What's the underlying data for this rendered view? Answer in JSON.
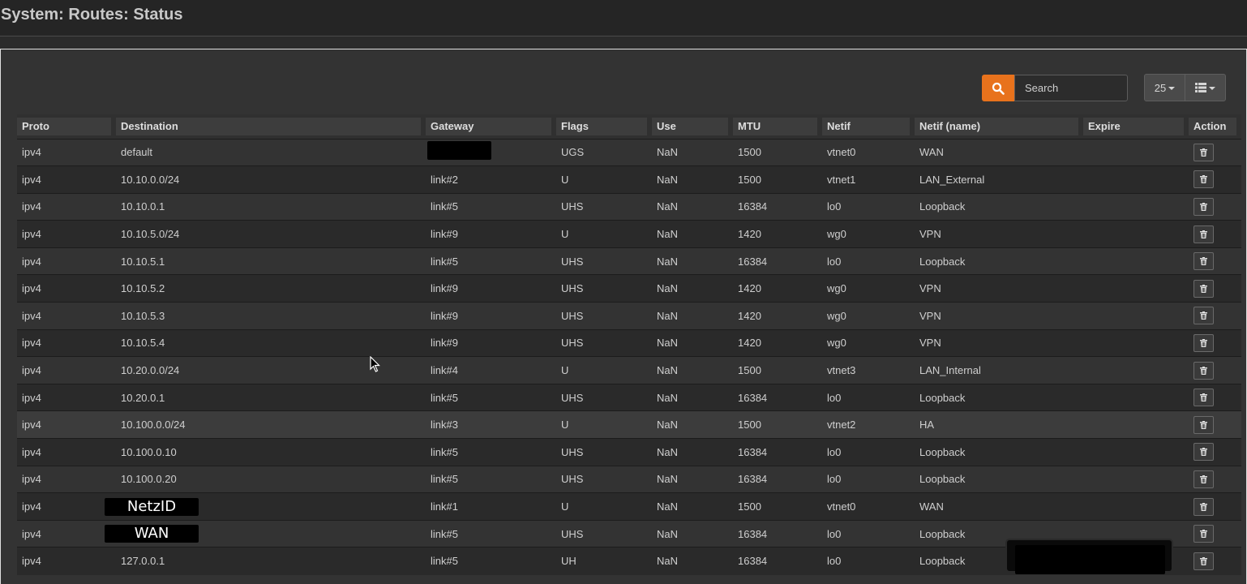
{
  "page": {
    "title": "System: Routes: Status"
  },
  "toolbar": {
    "search_placeholder": "Search",
    "page_size": "25",
    "search_icon": "search-icon",
    "columns_icon": "list-columns-icon"
  },
  "colors": {
    "accent": "#e8721c",
    "background": "#2b2b2b"
  },
  "table": {
    "columns": [
      "Proto",
      "Destination",
      "Gateway",
      "Flags",
      "Use",
      "MTU",
      "Netif",
      "Netif (name)",
      "Expire",
      "Action"
    ],
    "rows": [
      {
        "proto": "ipv4",
        "destination": "default",
        "gateway": "",
        "flags": "UGS",
        "use": "NaN",
        "mtu": "1500",
        "netif": "vtnet0",
        "netif_name": "WAN",
        "expire": ""
      },
      {
        "proto": "ipv4",
        "destination": "10.10.0.0/24",
        "gateway": "link#2",
        "flags": "U",
        "use": "NaN",
        "mtu": "1500",
        "netif": "vtnet1",
        "netif_name": "LAN_External",
        "expire": ""
      },
      {
        "proto": "ipv4",
        "destination": "10.10.0.1",
        "gateway": "link#5",
        "flags": "UHS",
        "use": "NaN",
        "mtu": "16384",
        "netif": "lo0",
        "netif_name": "Loopback",
        "expire": ""
      },
      {
        "proto": "ipv4",
        "destination": "10.10.5.0/24",
        "gateway": "link#9",
        "flags": "U",
        "use": "NaN",
        "mtu": "1420",
        "netif": "wg0",
        "netif_name": "VPN",
        "expire": ""
      },
      {
        "proto": "ipv4",
        "destination": "10.10.5.1",
        "gateway": "link#5",
        "flags": "UHS",
        "use": "NaN",
        "mtu": "16384",
        "netif": "lo0",
        "netif_name": "Loopback",
        "expire": ""
      },
      {
        "proto": "ipv4",
        "destination": "10.10.5.2",
        "gateway": "link#9",
        "flags": "UHS",
        "use": "NaN",
        "mtu": "1420",
        "netif": "wg0",
        "netif_name": "VPN",
        "expire": ""
      },
      {
        "proto": "ipv4",
        "destination": "10.10.5.3",
        "gateway": "link#9",
        "flags": "UHS",
        "use": "NaN",
        "mtu": "1420",
        "netif": "wg0",
        "netif_name": "VPN",
        "expire": ""
      },
      {
        "proto": "ipv4",
        "destination": "10.10.5.4",
        "gateway": "link#9",
        "flags": "UHS",
        "use": "NaN",
        "mtu": "1420",
        "netif": "wg0",
        "netif_name": "VPN",
        "expire": ""
      },
      {
        "proto": "ipv4",
        "destination": "10.20.0.0/24",
        "gateway": "link#4",
        "flags": "U",
        "use": "NaN",
        "mtu": "1500",
        "netif": "vtnet3",
        "netif_name": "LAN_Internal",
        "expire": ""
      },
      {
        "proto": "ipv4",
        "destination": "10.20.0.1",
        "gateway": "link#5",
        "flags": "UHS",
        "use": "NaN",
        "mtu": "16384",
        "netif": "lo0",
        "netif_name": "Loopback",
        "expire": ""
      },
      {
        "proto": "ipv4",
        "destination": "10.100.0.0/24",
        "gateway": "link#3",
        "flags": "U",
        "use": "NaN",
        "mtu": "1500",
        "netif": "vtnet2",
        "netif_name": "HA",
        "expire": ""
      },
      {
        "proto": "ipv4",
        "destination": "10.100.0.10",
        "gateway": "link#5",
        "flags": "UHS",
        "use": "NaN",
        "mtu": "16384",
        "netif": "lo0",
        "netif_name": "Loopback",
        "expire": ""
      },
      {
        "proto": "ipv4",
        "destination": "10.100.0.20",
        "gateway": "link#5",
        "flags": "UHS",
        "use": "NaN",
        "mtu": "16384",
        "netif": "lo0",
        "netif_name": "Loopback",
        "expire": ""
      },
      {
        "proto": "ipv4",
        "destination": "NetzID",
        "gateway": "link#1",
        "flags": "U",
        "use": "NaN",
        "mtu": "1500",
        "netif": "vtnet0",
        "netif_name": "WAN",
        "expire": ""
      },
      {
        "proto": "ipv4",
        "destination": "WAN",
        "gateway": "link#5",
        "flags": "UHS",
        "use": "NaN",
        "mtu": "16384",
        "netif": "lo0",
        "netif_name": "Loopback",
        "expire": ""
      },
      {
        "proto": "ipv4",
        "destination": "127.0.0.1",
        "gateway": "link#5",
        "flags": "UH",
        "use": "NaN",
        "mtu": "16384",
        "netif": "lo0",
        "netif_name": "Loopback",
        "expire": ""
      }
    ]
  }
}
